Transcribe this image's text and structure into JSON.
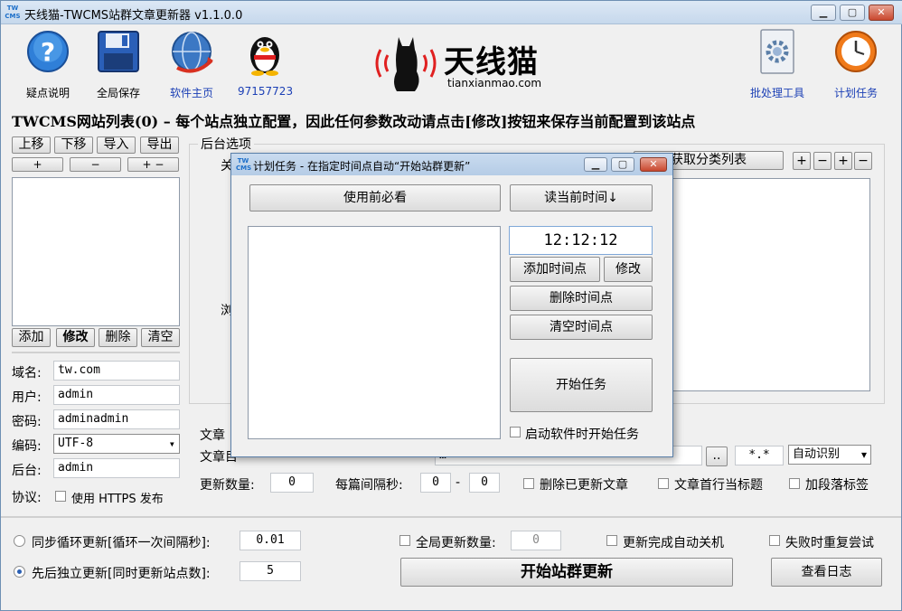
{
  "window": {
    "title": "天线猫-TWCMS站群文章更新器 v1.1.0.0",
    "icon_text": "TW CMS",
    "controls": [
      "minimize-icon",
      "maximize-icon",
      "close-icon"
    ]
  },
  "toolbar": {
    "help": "疑点说明",
    "save_all": "全局保存",
    "homepage": "软件主页",
    "qq": "97157723",
    "batch": "批处理工具",
    "schedule": "计划任务"
  },
  "logo": {
    "cn": "天线猫",
    "en": "tianxianmao.com"
  },
  "headline": "TWCMS网站列表(0) – 每个站点独立配置，因此任何参数改动请点击[修改]按钮来保存当前配置到该站点",
  "site_list": {
    "up": "上移",
    "down": "下移",
    "import": "导入",
    "export": "导出",
    "plus": "+",
    "minus": "−",
    "plusminus": "+ −",
    "add": "添加",
    "modify": "修改",
    "delete": "删除",
    "clear": "清空"
  },
  "site_form": {
    "domain_label": "域名:",
    "domain_value": "tw.com",
    "user_label": "用户:",
    "user_value": "admin",
    "pass_label": "密码:",
    "pass_value": "adminadmin",
    "encoding_label": "编码:",
    "encoding_value": "UTF-8",
    "backend_label": "后台:",
    "backend_value": "admin",
    "protocol_label": "协议:",
    "https_label": "使用 HTTPS 发布"
  },
  "backend": {
    "title": "后台选项",
    "partial_label_1": "关",
    "partial_label_2": "浏",
    "category_button": "获取分类列表",
    "btn_plus": "+",
    "btn_minus": "−",
    "btn_plus2": "+",
    "btn_minus2": "−"
  },
  "article": {
    "partial_title": "文章",
    "dir_label": "文章目",
    "dir_value": "…",
    "browse": "..",
    "pattern": "*.*",
    "detect": "自动识别",
    "update_count_label": "更新数量:",
    "update_count": "0",
    "interval_label": "每篇间隔秒:",
    "interval_from": "0",
    "interval_sep": "-",
    "interval_to": "0",
    "delete_updated": "删除已更新文章",
    "first_line_title": "文章首行当标题",
    "add_para_tag": "加段落标签"
  },
  "bottom": {
    "sync_loop_label": "同步循环更新[循环一次间隔秒]:",
    "sync_loop_value": "0.01",
    "sequential_label": "先后独立更新[同时更新站点数]:",
    "sequential_value": "5",
    "global_count_label": "全局更新数量:",
    "global_count_value": "0",
    "auto_shutdown": "更新完成自动关机",
    "retry_on_fail": "失败时重复尝试",
    "start_button": "开始站群更新",
    "view_log": "查看日志"
  },
  "dialog": {
    "title": "计划任务 - 在指定时间点自动“开始站群更新”",
    "must_read": "使用前必看",
    "read_time": "读当前时间↓",
    "time_value": "12:12:12",
    "add_time": "添加时间点",
    "modify": "修改",
    "delete_time": "删除时间点",
    "clear_time": "清空时间点",
    "start_task": "开始任务",
    "start_on_launch": "启动软件时开始任务"
  },
  "colors": {
    "accent_blue": "#1b3fb5",
    "title_bar": "#c6d8ec",
    "close_red": "#c9472e",
    "logo_red": "#e02020"
  }
}
